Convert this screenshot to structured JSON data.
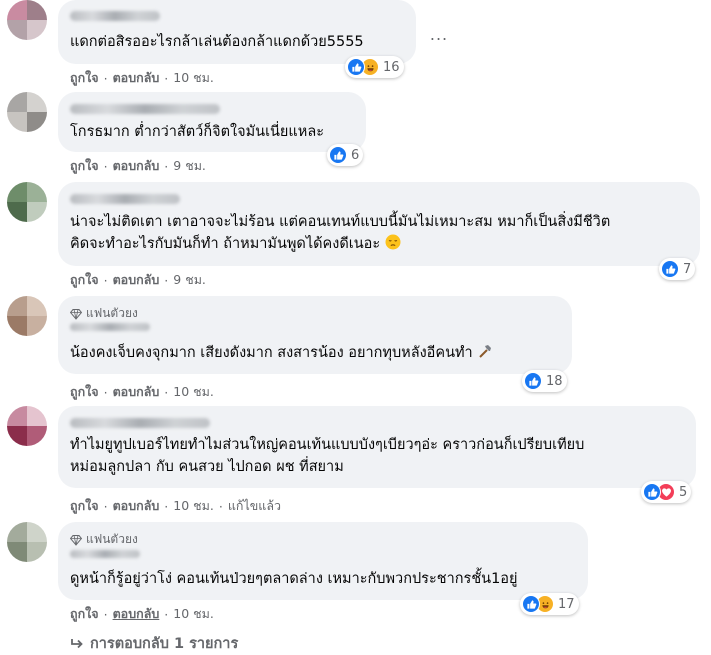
{
  "comments": [
    {
      "badge": "",
      "text_lines": [
        "แดกต่อสิรออะไรกล้าเล่นต้องกล้าแดกด้วย5555"
      ],
      "reactions": [
        "like",
        "haha"
      ],
      "reaction_count": "16",
      "actions": {
        "like": "ถูกใจ",
        "reply": "ตอบกลับ",
        "time": "10 ชม.",
        "edited": ""
      }
    },
    {
      "badge": "",
      "text_lines": [
        "โกรธมาก ต่ำกว่าสัตว์ก็จิตใจมันเนี่ยแหละ"
      ],
      "reactions": [
        "like"
      ],
      "reaction_count": "6",
      "actions": {
        "like": "ถูกใจ",
        "reply": "ตอบกลับ",
        "time": "9 ชม.",
        "edited": ""
      }
    },
    {
      "badge": "",
      "text_lines": [
        "น่าจะไม่ติดเตา เตาอาจจะไม่ร้อน แต่คอนเทนท์แบบนี้มันไม่เหมาะสม หมาก็เป็นสิ่งมีชีวิต",
        "คิดจะทำอะไรกับมันก็ทำ ถ้าหมามันพูดได้คงดีเนอะ"
      ],
      "reactions": [
        "like"
      ],
      "reaction_count": "7",
      "actions": {
        "like": "ถูกใจ",
        "reply": "ตอบกลับ",
        "time": "9 ชม.",
        "edited": ""
      }
    },
    {
      "badge": "แฟนตัวยง",
      "text_lines": [
        "น้องคงเจ็บคงจุกมาก เสียงดังมาก สงสารน้อง อยากทุบหลังอีคนทำ"
      ],
      "reactions": [
        "like"
      ],
      "reaction_count": "18",
      "actions": {
        "like": "ถูกใจ",
        "reply": "ตอบกลับ",
        "time": "10 ชม.",
        "edited": ""
      }
    },
    {
      "badge": "",
      "text_lines": [
        "ทำไมยูทูปเบอร์ไทยทำไมส่วนใหญ่คอนเท้นแบบบังๆเบียวๆอ่ะ คราวก่อนก็เปรียบเทียบ",
        "หม่อมลูกปลา กับ คนสวย ไปกอด ผช ที่สยาม"
      ],
      "reactions": [
        "like",
        "love"
      ],
      "reaction_count": "5",
      "actions": {
        "like": "ถูกใจ",
        "reply": "ตอบกลับ",
        "time": "10 ชม.",
        "edited": "แก้ไขแล้ว"
      }
    },
    {
      "badge": "แฟนตัวยง",
      "text_lines": [
        "ดูหน้าก็รู้อยู่ว่าโง่ คอนเท้นป่วยๆตลาดล่าง เหมาะกับพวกประชากรชั้น1อยู่"
      ],
      "reactions": [
        "like",
        "haha"
      ],
      "reaction_count": "17",
      "actions": {
        "like": "ถูกใจ",
        "reply": "ตอบกลับ",
        "time": "10 ชม.",
        "edited": ""
      }
    }
  ],
  "more_options_label": "...",
  "replies_link": "การตอบกลับ 1 รายการ",
  "icons": {
    "like": "thumbs-up-icon",
    "haha": "laughing-face-icon",
    "love": "heart-icon",
    "pensive": "pensive-face-emoji",
    "hammer": "hammer-emoji",
    "diamond": "diamond-icon",
    "reply_arrow": "reply-arrow-icon"
  },
  "colors": {
    "bubble": "#f0f2f5",
    "secondary_text": "#65676b",
    "like_blue": "#1877f2",
    "haha_yellow": "#f7b125",
    "love_red": "#f33e58"
  }
}
